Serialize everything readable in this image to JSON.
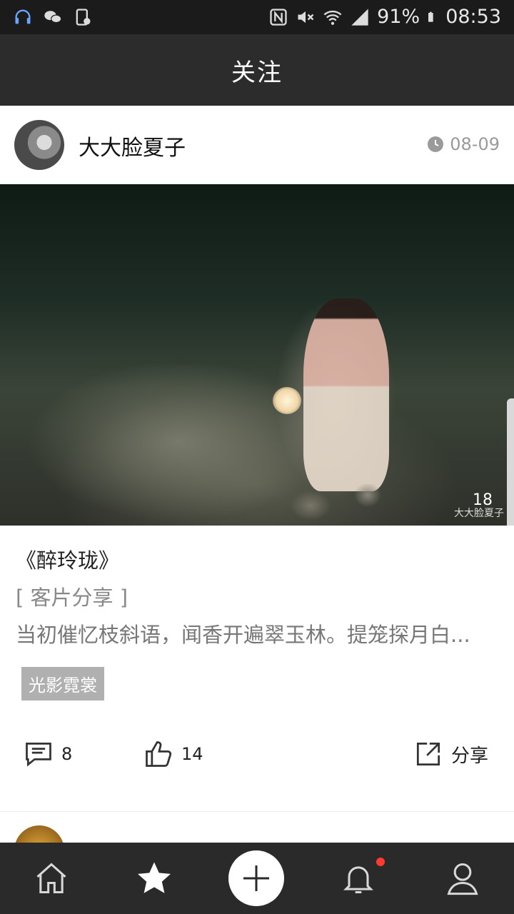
{
  "status_bar": {
    "battery": "91%",
    "time": "08:53",
    "left_icons": [
      "headset-icon",
      "wechat-icon",
      "phone-app-icon"
    ],
    "right_icons": [
      "nfc-icon",
      "mute-icon",
      "wifi-icon",
      "signal-icon",
      "battery-icon"
    ]
  },
  "header": {
    "title": "关注"
  },
  "post": {
    "username": "大大脸夏子",
    "date": "08-09",
    "photo_count": "18",
    "watermark": "大大脸夏子",
    "title": "《醉玲珑》",
    "category": "[ 客片分享 ]",
    "description": "当初催忆枝斜语，闻香开遍翠玉林。提笼探月白...",
    "tag": "光影霓裳",
    "comments": "8",
    "likes": "14",
    "share_label": "分享"
  },
  "bottom_nav": {
    "items": [
      "home-icon",
      "star-icon",
      "plus-icon",
      "bell-icon",
      "profile-icon"
    ],
    "notification_color": "#ff3b30"
  }
}
